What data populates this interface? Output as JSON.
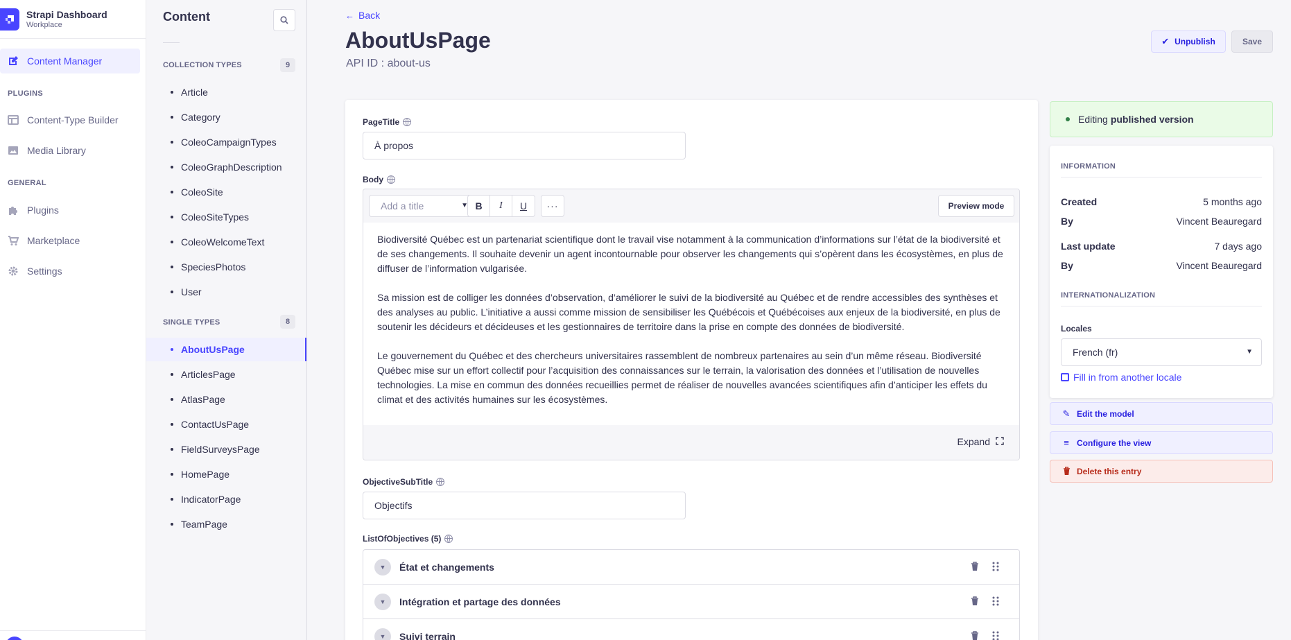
{
  "app": {
    "name": "Strapi Dashboard",
    "workspace": "Workplace"
  },
  "leftnav": {
    "content_manager": "Content Manager",
    "plugins_heading": "PLUGINS",
    "content_type_builder": "Content-Type Builder",
    "media_library": "Media Library",
    "general_heading": "GENERAL",
    "plugins": "Plugins",
    "marketplace": "Marketplace",
    "settings": "Settings"
  },
  "subnav": {
    "title": "Content",
    "collection_heading": "COLLECTION TYPES",
    "collection_count": "9",
    "collection_items": [
      "Article",
      "Category",
      "ColeoCampaignTypes",
      "ColeoGraphDescription",
      "ColeoSite",
      "ColeoSiteTypes",
      "ColeoWelcomeText",
      "SpeciesPhotos",
      "User"
    ],
    "single_heading": "SINGLE TYPES",
    "single_count": "8",
    "single_items": [
      "AboutUsPage",
      "ArticlesPage",
      "AtlasPage",
      "ContactUsPage",
      "FieldSurveysPage",
      "HomePage",
      "IndicatorPage",
      "TeamPage"
    ]
  },
  "header": {
    "back": "Back",
    "title": "AboutUsPage",
    "subtitle": "API ID : about-us",
    "unpublish": "Unpublish",
    "save": "Save"
  },
  "form": {
    "page_title_label": "PageTitle",
    "page_title_value": "À propos",
    "body_label": "Body",
    "add_title_placeholder": "Add a title",
    "preview_mode": "Preview mode",
    "body_paragraphs": [
      "Biodiversité Québec est un partenariat scientifique dont le travail vise notamment à la communication d’informations sur l’état de la biodiversité et de ses changements. Il souhaite devenir un agent incontournable pour observer les changements qui s’opèrent dans les écosystèmes, en plus de diffuser de l’information vulgarisée.",
      "Sa mission est de colliger les données d’observation, d’améliorer le suivi de la biodiversité au Québec et de rendre accessibles des synthèses et des analyses au public. L’initiative a aussi comme mission de sensibiliser les Québécois et Québécoises aux enjeux de la biodiversité, en plus de soutenir les décideurs et décideuses et les gestionnaires de territoire dans la prise en compte des données de biodiversité.",
      "Le gouvernement du Québec et des chercheurs universitaires rassemblent de nombreux partenaires au sein d’un même réseau. Biodiversité Québec mise sur un effort collectif pour l’acquisition des connaissances sur le terrain, la valorisation des données et l’utilisation de nouvelles technologies. La mise en commun des données recueillies permet de réaliser de nouvelles avancées scientifiques afin d’anticiper les effets du climat et des activités humaines sur les écosystèmes."
    ],
    "expand": "Expand",
    "objective_subtitle_label": "ObjectiveSubTitle",
    "objective_subtitle_value": "Objectifs",
    "list_label": "ListOfObjectives (5)",
    "objectives": [
      "État et changements",
      "Intégration et partage des données",
      "Suivi terrain"
    ]
  },
  "sidebar": {
    "status_prefix": "Editing",
    "status_bold": "published version",
    "information_heading": "INFORMATION",
    "created_label": "Created",
    "created_value": "5 months ago",
    "by_label": "By",
    "created_by": "Vincent Beauregard",
    "updated_label": "Last update",
    "updated_value": "7 days ago",
    "updated_by": "Vincent Beauregard",
    "i18n_heading": "INTERNATIONALIZATION",
    "locales_label": "Locales",
    "locale_value": "French (fr)",
    "fill_in": "Fill in from another locale",
    "edit_model": "Edit the model",
    "configure_view": "Configure the view",
    "delete_entry": "Delete this entry"
  },
  "colors": {
    "primary": "#4945ff",
    "success_bg": "#eafbe7",
    "danger": "#b72b1a"
  }
}
